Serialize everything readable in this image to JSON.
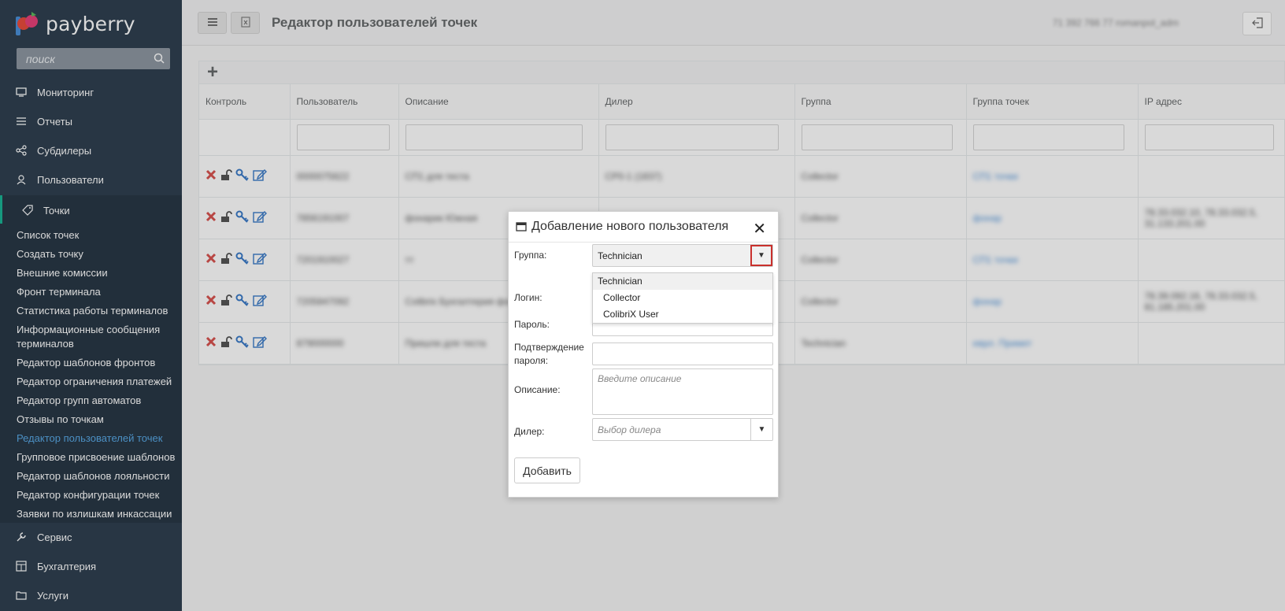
{
  "app": {
    "brand": "payberry",
    "search_placeholder": "поиск"
  },
  "nav": {
    "items": [
      {
        "label": "Мониторинг",
        "icon": "monitor-icon"
      },
      {
        "label": "Отчеты",
        "icon": "list-icon"
      },
      {
        "label": "Субдилеры",
        "icon": "share-icon"
      },
      {
        "label": "Пользователи",
        "icon": "users-icon"
      },
      {
        "label": "Точки",
        "icon": "tag-icon"
      },
      {
        "label": "Сервис",
        "icon": "wrench-icon"
      },
      {
        "label": "Бухгалтерия",
        "icon": "calculator-icon"
      },
      {
        "label": "Услуги",
        "icon": "folder-icon"
      }
    ],
    "sub_items": [
      "Список точек",
      "Создать точку",
      "Внешние комиссии",
      "Фронт терминала",
      "Статистика работы терминалов",
      "Информационные сообщения терминалов",
      "Редактор шаблонов фронтов",
      "Редактор ограничения платежей",
      "Редактор групп автоматов",
      "Отзывы по точкам",
      "Редактор пользователей точек",
      "Групповое присвоение шаблонов",
      "Редактор шаблонов лояльности",
      "Редактор конфигурации точек",
      "Заявки по излишкам инкассации"
    ]
  },
  "header": {
    "title": "Редактор пользователей точек",
    "user_info": "71 392 766 77   romanpol_adm"
  },
  "table": {
    "columns": [
      "Контроль",
      "Пользователь",
      "Описание",
      "Дилер",
      "Группа",
      "Группа точек",
      "IP адрес"
    ],
    "rows": [
      [
        "",
        "0000075622",
        "СП1 для теста",
        "СР0-1 (1837)",
        "Сollector",
        "СП1 точки",
        ""
      ],
      [
        "",
        "7856191007",
        "фонарик Южная",
        "",
        "Сollector",
        "фонар",
        "78.33.032.10, 78.33.032.5, 31.133.201.00"
      ],
      [
        "",
        "7201910027",
        "тт",
        "",
        "Сollector",
        "СП1 точки",
        ""
      ],
      [
        "",
        "7205847092",
        "Colibrix Бухгалтерия фонарик",
        "",
        "Сollector",
        "фонар",
        "78.39.092.16, 78.33.032.5, 81.185.201.00"
      ],
      [
        "",
        "879000000",
        "Пришли для теста",
        "",
        "Technician",
        "еврл. Примет",
        ""
      ]
    ]
  },
  "modal": {
    "title": "Добавление нового пользователя",
    "group_label": "Группа:",
    "group_value": "Technician",
    "group_options": [
      "Technician",
      "Collector",
      "ColibriX User"
    ],
    "login_label": "Логин:",
    "password_label": "Пароль:",
    "confirm_label": "Подтверждение пароля:",
    "description_label": "Описание:",
    "description_placeholder": "Введите описание",
    "dealer_label": "Дилер:",
    "dealer_placeholder": "Выбор дилера",
    "add_button": "Добавить"
  }
}
